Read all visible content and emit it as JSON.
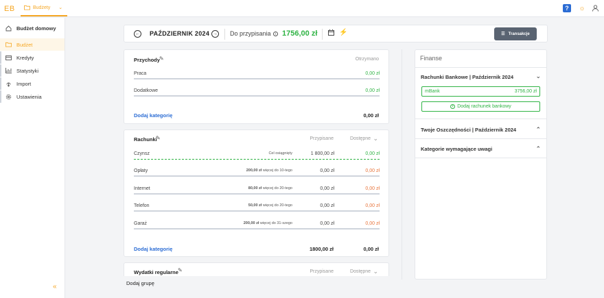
{
  "app": {
    "logo": "EB",
    "nav_tab": "Budżety"
  },
  "sidebar": {
    "header": "Budżet domowy",
    "items": [
      {
        "label": "Budżet"
      },
      {
        "label": "Kredyty"
      },
      {
        "label": "Statystyki"
      },
      {
        "label": "Import"
      },
      {
        "label": "Ustawienia"
      }
    ],
    "collapse_glyph": "«"
  },
  "month_bar": {
    "month": "PAŹDZIERNIK 2024",
    "assign_label": "Do przypisania",
    "assign_value": "1756,00 zł",
    "transactions_button": "Transakcje"
  },
  "groups": {
    "income": {
      "title": "Przychody",
      "col_received": "Otrzymano",
      "rows": [
        {
          "label": "Praca",
          "value": "0,00 zł"
        },
        {
          "label": "Dodatkowe",
          "value": "0,00 zł"
        }
      ],
      "add_category": "Dodaj kategorię",
      "total": "0,00 zł"
    },
    "bills": {
      "title": "Rachunki",
      "col_assigned": "Przypisane",
      "col_available": "Dostępne",
      "rows": [
        {
          "label": "Czynsz",
          "note": "Cel osiągnięty",
          "note_amount": "",
          "note_text": "",
          "assigned": "1 800,00 zł",
          "available": "0,00 zł"
        },
        {
          "label": "Opłaty",
          "note": "",
          "note_amount": "200,00 zł",
          "note_text": "więcej do 10-tego",
          "assigned": "0,00 zł",
          "available": "0,00 zł"
        },
        {
          "label": "Internet",
          "note": "",
          "note_amount": "80,00 zł",
          "note_text": "więcej do 20-tego",
          "assigned": "0,00 zł",
          "available": "0,00 zł"
        },
        {
          "label": "Telefon",
          "note": "",
          "note_amount": "50,00 zł",
          "note_text": "więcej do 20-tego",
          "assigned": "0,00 zł",
          "available": "0,00 zł"
        },
        {
          "label": "Garaż",
          "note": "",
          "note_amount": "200,00 zł",
          "note_text": "więcej do 31-szego",
          "assigned": "0,00 zł",
          "available": "0,00 zł"
        }
      ],
      "add_category": "Dodaj kategorię",
      "total_assigned": "1800,00 zł",
      "total_available": "0,00 zł"
    },
    "regular": {
      "title": "Wydatki regularne",
      "col_assigned": "Przypisane",
      "col_available": "Dostępne"
    }
  },
  "add_group": "Dodaj grupę",
  "finance": {
    "title": "Finanse",
    "bank_section": "Rachunki Bankowe | Październik 2024",
    "bank_accounts": [
      {
        "name": "mBank",
        "balance": "3756,00 zł"
      }
    ],
    "add_bank": "Dodaj rachunek bankowy",
    "savings_section": "Twoje Oszczędności | Październik 2024",
    "attention_section": "Kategorie wymagające uwagi"
  },
  "colors": {
    "accent": "#f5a623",
    "green": "#2fb344",
    "orange": "#e8743b",
    "blue": "#2b6cd4",
    "button": "#5a6472"
  },
  "icons": [
    "folder-icon",
    "chevron-down-icon",
    "help-icon",
    "sun-icon",
    "user-icon",
    "home-icon",
    "credit-card-icon",
    "chart-icon",
    "import-icon",
    "gear-icon",
    "arrow-left-icon",
    "arrow-right-icon",
    "info-icon",
    "calendar-icon",
    "bolt-icon",
    "list-icon",
    "pencil-icon",
    "chevron-up-icon",
    "plus-circle-icon"
  ]
}
